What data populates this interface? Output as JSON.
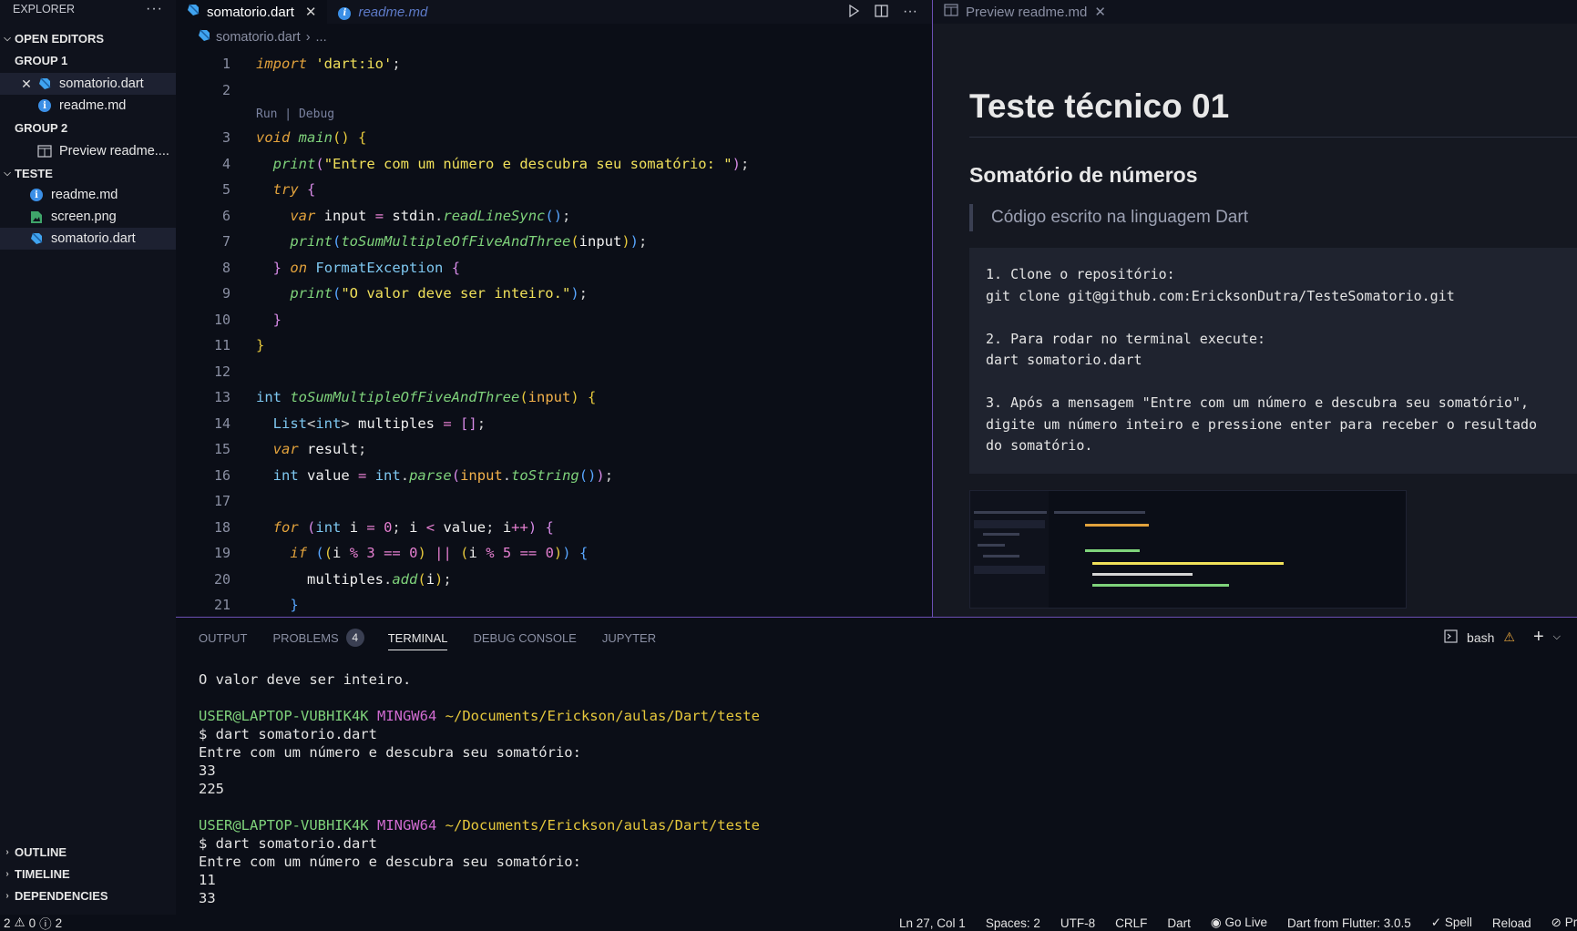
{
  "sidebar": {
    "header": "EXPLORER",
    "open_editors_label": "OPEN EDITORS",
    "group1_label": "GROUP 1",
    "group1_items": [
      "somatorio.dart",
      "readme.md"
    ],
    "group2_label": "GROUP 2",
    "group2_items": [
      "Preview readme...."
    ],
    "folder_label": "TESTE",
    "folder_items": [
      "readme.md",
      "screen.png",
      "somatorio.dart"
    ],
    "outline_label": "OUTLINE",
    "timeline_label": "TIMELINE",
    "dependencies_label": "DEPENDENCIES"
  },
  "editor": {
    "tabs": [
      "somatorio.dart",
      "readme.md"
    ],
    "breadcrumb_file": "somatorio.dart",
    "breadcrumb_more": "...",
    "codelens": "Run | Debug",
    "line_numbers": [
      "1",
      "2",
      "3",
      "4",
      "5",
      "6",
      "7",
      "8",
      "9",
      "10",
      "11",
      "12",
      "13",
      "14",
      "15",
      "16",
      "17",
      "18",
      "19",
      "20",
      "21"
    ]
  },
  "preview": {
    "tab_label": "Preview readme.md",
    "h1": "Teste técnico 01",
    "h2": "Somatório de números",
    "quote": "Código escrito na linguagem Dart",
    "pre": "1. Clone o repositório:\ngit clone git@github.com:EricksonDutra/TesteSomatorio.git\n\n2. Para rodar no terminal execute:\ndart somatorio.dart\n\n3. Após a mensagem \"Entre com um número e descubra seu somatório\",\ndigite um número inteiro e pressione enter para receber o resultado\ndo somatório."
  },
  "panel": {
    "tabs": [
      "OUTPUT",
      "PROBLEMS",
      "TERMINAL",
      "DEBUG CONSOLE",
      "JUPYTER"
    ],
    "problems_count": "4",
    "shell": "bash",
    "terminal": {
      "line1": "O valor deve ser inteiro.",
      "user": "USER@LAPTOP-VUBHIK4K",
      "host": "MINGW64",
      "path": "~/Documents/Erickson/aulas/Dart/teste",
      "cmd": "$ dart somatorio.dart",
      "prompt": "Entre com um número e descubra seu somatório:",
      "run1_in": "33",
      "run1_out": "225",
      "run2_in": "11",
      "run2_out": "33"
    }
  },
  "status": {
    "errors": "2",
    "warnings": "0",
    "infos": "2",
    "position": "Ln 27, Col 1",
    "spaces": "Spaces: 2",
    "encoding": "UTF-8",
    "eol": "CRLF",
    "language": "Dart",
    "golive": "Go Live",
    "sdk": "Dart from Flutter: 3.0.5",
    "spell": "Spell",
    "reload": "Reload",
    "prettier": "Pr"
  },
  "colors": {
    "accent": "#6b4fb3",
    "dart_blue": "#40a4f0",
    "info_blue": "#3b8fe6"
  }
}
